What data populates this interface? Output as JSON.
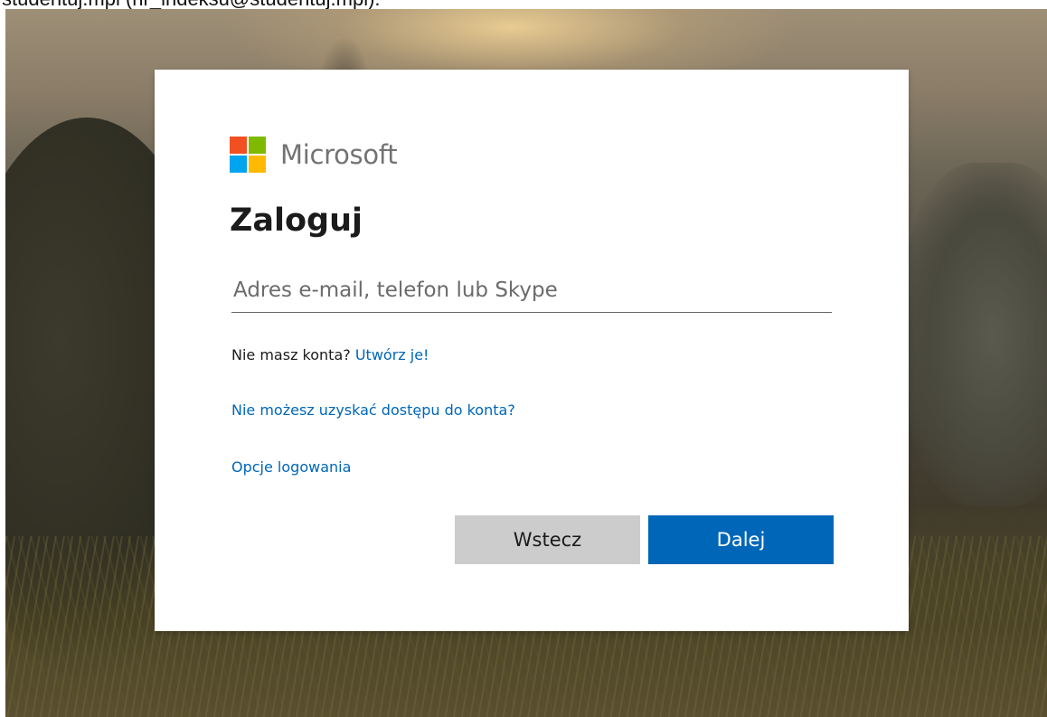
{
  "caption": "studentuj.mpl (nr_indeksu@studentuj.mpl).",
  "logo": {
    "text": "Microsoft",
    "colors": [
      "#f25022",
      "#7fba00",
      "#00a4ef",
      "#ffb900"
    ],
    "icon": "microsoft-logo-icon"
  },
  "signin": {
    "title": "Zaloguj",
    "email_placeholder": "Adres e-mail, telefon lub Skype",
    "email_value": "",
    "no_account_text": "Nie masz konta? ",
    "create_link": "Utwórz je!",
    "cant_access_link": "Nie możesz uzyskać dostępu do konta?",
    "options_link": "Opcje logowania"
  },
  "buttons": {
    "back_label": "Wstecz",
    "next_label": "Dalej"
  },
  "colors": {
    "accent": "#0067b8",
    "back_button_bg": "#cccccc",
    "card_bg": "#ffffff"
  }
}
